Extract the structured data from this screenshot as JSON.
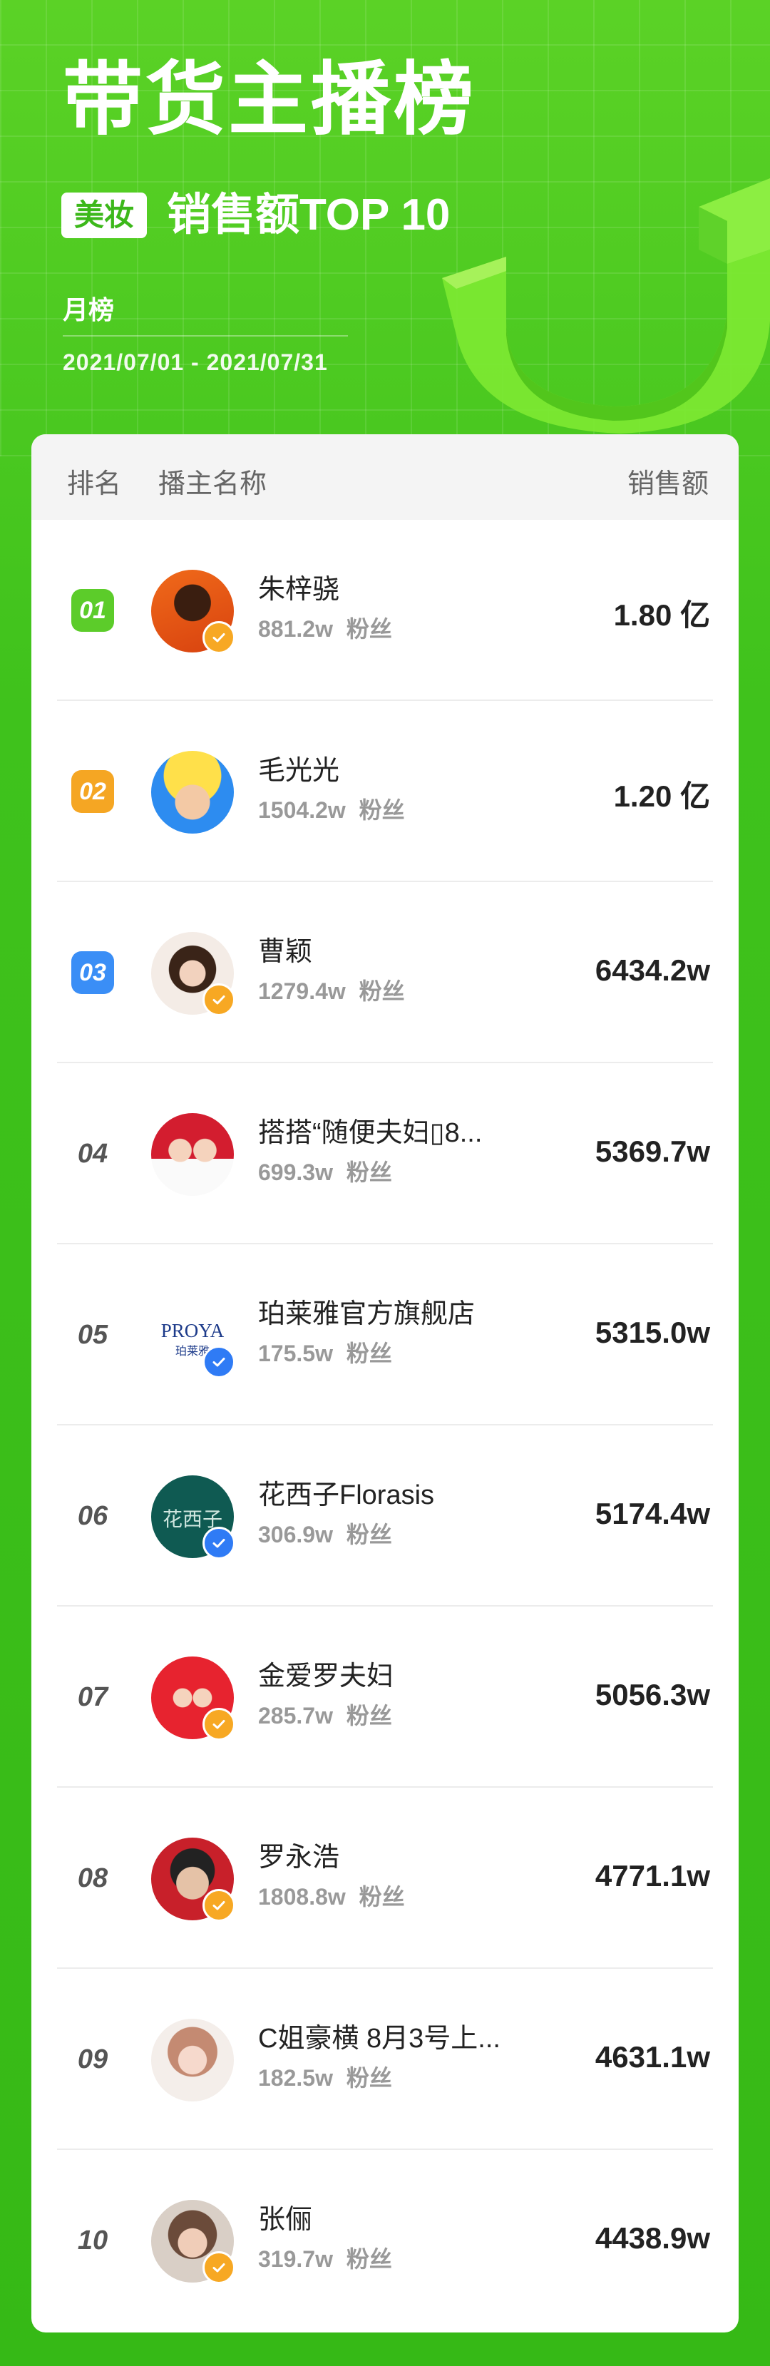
{
  "header": {
    "title": "带货主播榜",
    "category": "美妆",
    "subtitle": "销售额TOP 10",
    "period": "月榜",
    "date_range": "2021/07/01 - 2021/07/31"
  },
  "table": {
    "col_rank": "排名",
    "col_name": "播主名称",
    "col_sales": "销售额",
    "fans_suffix": "粉丝",
    "rows": [
      {
        "rank": "01",
        "name": "朱梓骁",
        "fans": "881.2w",
        "sales": "1.80 亿",
        "verify": "yellow"
      },
      {
        "rank": "02",
        "name": "毛光光",
        "fans": "1504.2w",
        "sales": "1.20 亿",
        "verify": "none"
      },
      {
        "rank": "03",
        "name": "曹颖",
        "fans": "1279.4w",
        "sales": "6434.2w",
        "verify": "yellow"
      },
      {
        "rank": "04",
        "name": "搭搭“随便夫妇▯8...",
        "fans": "699.3w",
        "sales": "5369.7w",
        "verify": "none"
      },
      {
        "rank": "05",
        "name": "珀莱雅官方旗舰店",
        "fans": "175.5w",
        "sales": "5315.0w",
        "verify": "blue",
        "logo_text": "PROYA",
        "logo_sub": "珀莱雅"
      },
      {
        "rank": "06",
        "name": "花西子Florasis",
        "fans": "306.9w",
        "sales": "5174.4w",
        "verify": "blue",
        "logo_text": "花西子"
      },
      {
        "rank": "07",
        "name": "金爱罗夫妇",
        "fans": "285.7w",
        "sales": "5056.3w",
        "verify": "yellow"
      },
      {
        "rank": "08",
        "name": "罗永浩",
        "fans": "1808.8w",
        "sales": "4771.1w",
        "verify": "yellow"
      },
      {
        "rank": "09",
        "name": "C姐豪横 8月3号上...",
        "fans": "182.5w",
        "sales": "4631.1w",
        "verify": "none"
      },
      {
        "rank": "10",
        "name": "张俪",
        "fans": "319.7w",
        "sales": "4438.9w",
        "verify": "yellow"
      }
    ]
  },
  "colors": {
    "background": "#3cc21a",
    "rank1": "#5ccc2a",
    "rank2": "#f5a623",
    "rank3": "#3a8ef6",
    "verify_yellow": "#f7a823",
    "verify_blue": "#2f7bf5"
  }
}
